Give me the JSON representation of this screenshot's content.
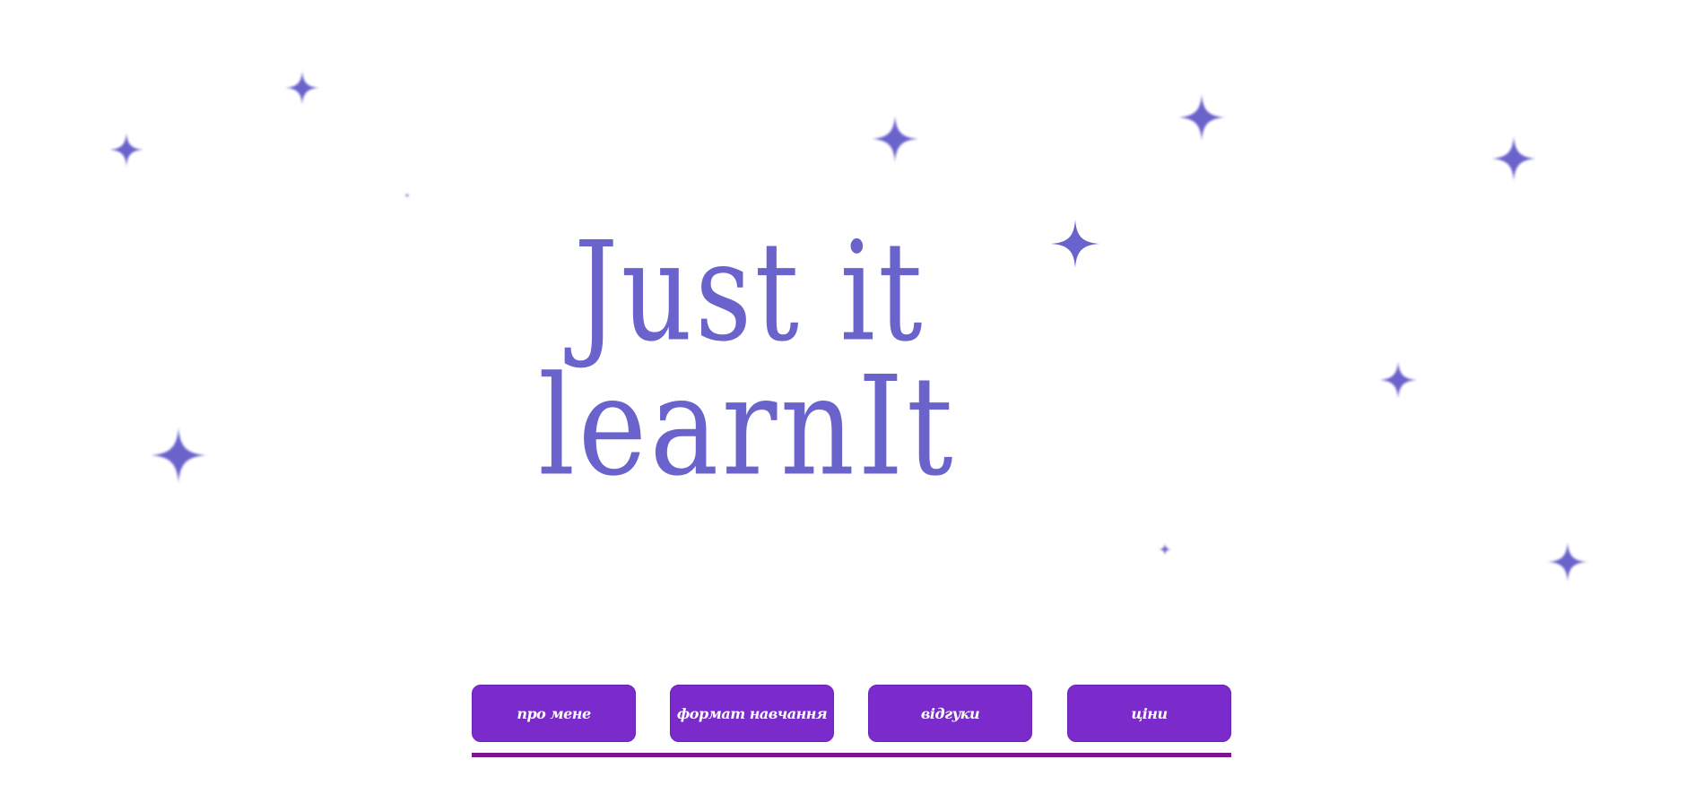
{
  "brand": {
    "logo_line_1": "Just it",
    "logo_line_2": "learnIt",
    "accent_color": "#6b63cc"
  },
  "nav": {
    "items": [
      {
        "label": "про мене"
      },
      {
        "label": "формат навчання"
      },
      {
        "label": "відгуки"
      },
      {
        "label": "ціни"
      }
    ],
    "button_color": "#7b2acb",
    "underline_color": "#7e148f"
  },
  "decorations": {
    "sparkle_icon": "four-point-star-icon",
    "sparkle_color": "#6b63cc"
  }
}
